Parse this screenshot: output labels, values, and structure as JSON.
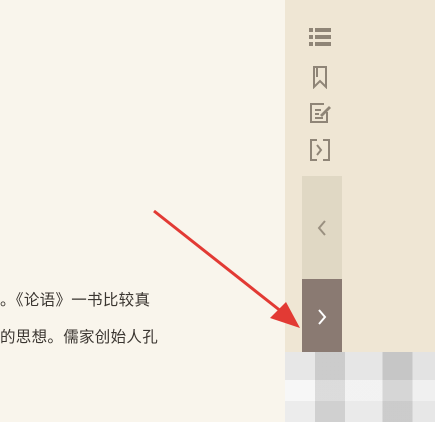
{
  "reader": {
    "lines": [
      "。《论语》一书比较真",
      "的思想。儒家创始人孔"
    ]
  },
  "toolbar": {
    "icons": [
      "list-icon",
      "bookmark-icon",
      "edit-note-icon",
      "fit-width-icon"
    ]
  },
  "pager": {
    "prev_glyph": "chevron-left-icon",
    "next_glyph": "chevron-right-icon"
  },
  "colors": {
    "page_bg": "#f9f5ec",
    "sidebar_bg": "#efe6d4",
    "icon": "#8f8577",
    "prev_bg": "#e0d8c4",
    "next_bg": "#8a7a72",
    "arrow": "#e23a34"
  }
}
